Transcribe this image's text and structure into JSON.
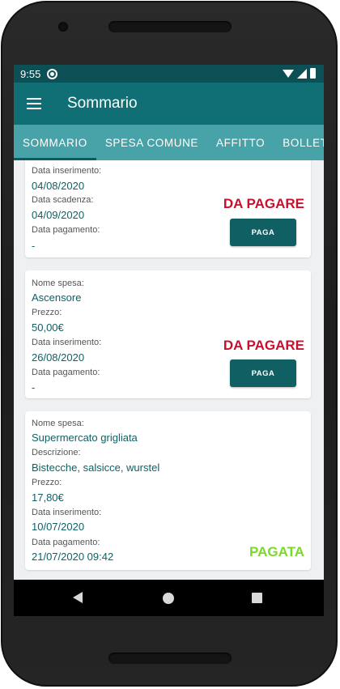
{
  "status_bar": {
    "time": "9:55"
  },
  "app_bar": {
    "title": "Sommario"
  },
  "tabs": [
    {
      "label": "SOMMARIO"
    },
    {
      "label": "SPESA COMUNE"
    },
    {
      "label": "AFFITTO"
    },
    {
      "label": "BOLLETTE"
    }
  ],
  "cards": [
    {
      "fields": [
        {
          "label": "Data inserimento:",
          "value": "04/08/2020"
        },
        {
          "label": "Data scadenza:",
          "value": "04/09/2020"
        },
        {
          "label": "Data pagamento:",
          "value": "-"
        }
      ],
      "status": "DA PAGARE",
      "button_label": "PAGA"
    },
    {
      "fields": [
        {
          "label": "Nome spesa:",
          "value": "Ascensore"
        },
        {
          "label": "Prezzo:",
          "value": "50,00€"
        },
        {
          "label": "Data inserimento:",
          "value": "26/08/2020"
        },
        {
          "label": "Data pagamento:",
          "value": "-"
        }
      ],
      "status": "DA PAGARE",
      "button_label": "PAGA"
    },
    {
      "fields": [
        {
          "label": "Nome spesa:",
          "value": "Supermercato grigliata"
        },
        {
          "label": "Descrizione:",
          "value": "Bistecche, salsicce, wurstel"
        },
        {
          "label": "Prezzo:",
          "value": "17,80€"
        },
        {
          "label": "Data inserimento:",
          "value": "10/07/2020"
        },
        {
          "label": "Data pagamento:",
          "value": "21/07/2020 09:42"
        }
      ],
      "status": "PAGATA"
    }
  ],
  "colors": {
    "status_bar": "#0c4f55",
    "app_bar": "#0f6f74",
    "tab_bar": "#48a3a8",
    "unpaid": "#c8102e",
    "paid": "#7bd92b",
    "button": "#0f5f63"
  }
}
